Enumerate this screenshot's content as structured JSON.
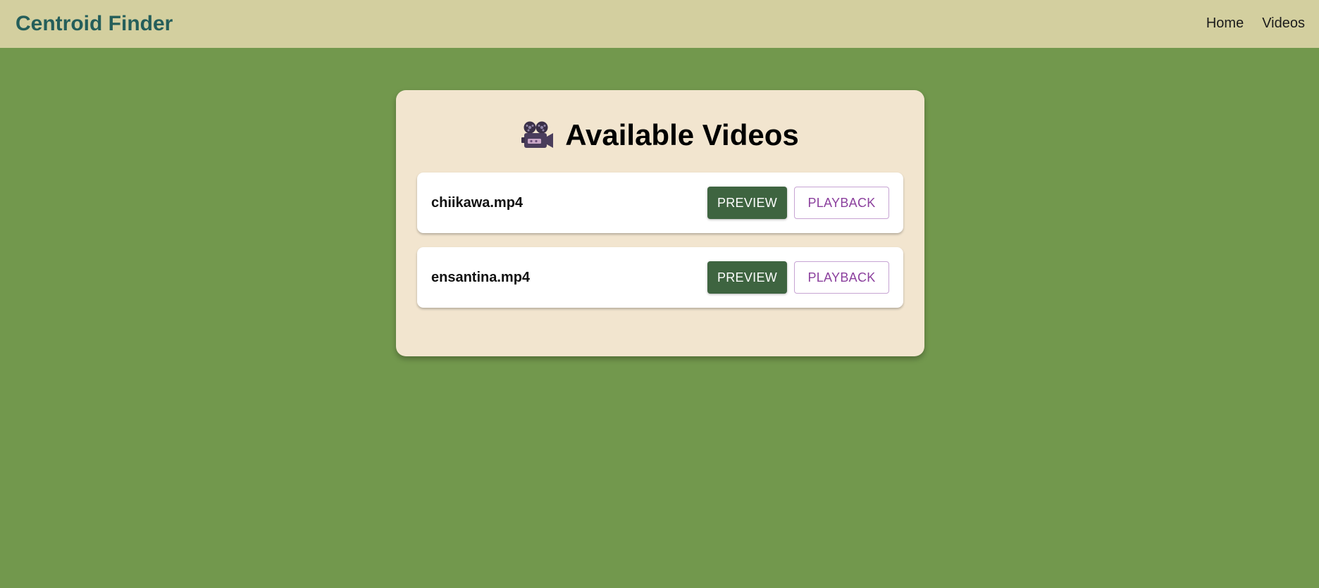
{
  "navbar": {
    "brand": "Centroid Finder",
    "links": [
      "Home",
      "Videos"
    ]
  },
  "panel": {
    "title": "Available Videos",
    "title_icon": "movie-camera-icon"
  },
  "videos": [
    {
      "name": "chiikawa.mp4",
      "preview_label": "PREVIEW",
      "playback_label": "PLAYBACK"
    },
    {
      "name": "ensantina.mp4",
      "preview_label": "PREVIEW",
      "playback_label": "PLAYBACK"
    }
  ],
  "colors": {
    "background": "#72984d",
    "navbar": "#d3cf9f",
    "brand": "#245e5a",
    "panel": "#f2e5cf",
    "preview_button": "#3e6440",
    "playback_text": "#8b3f9d"
  }
}
